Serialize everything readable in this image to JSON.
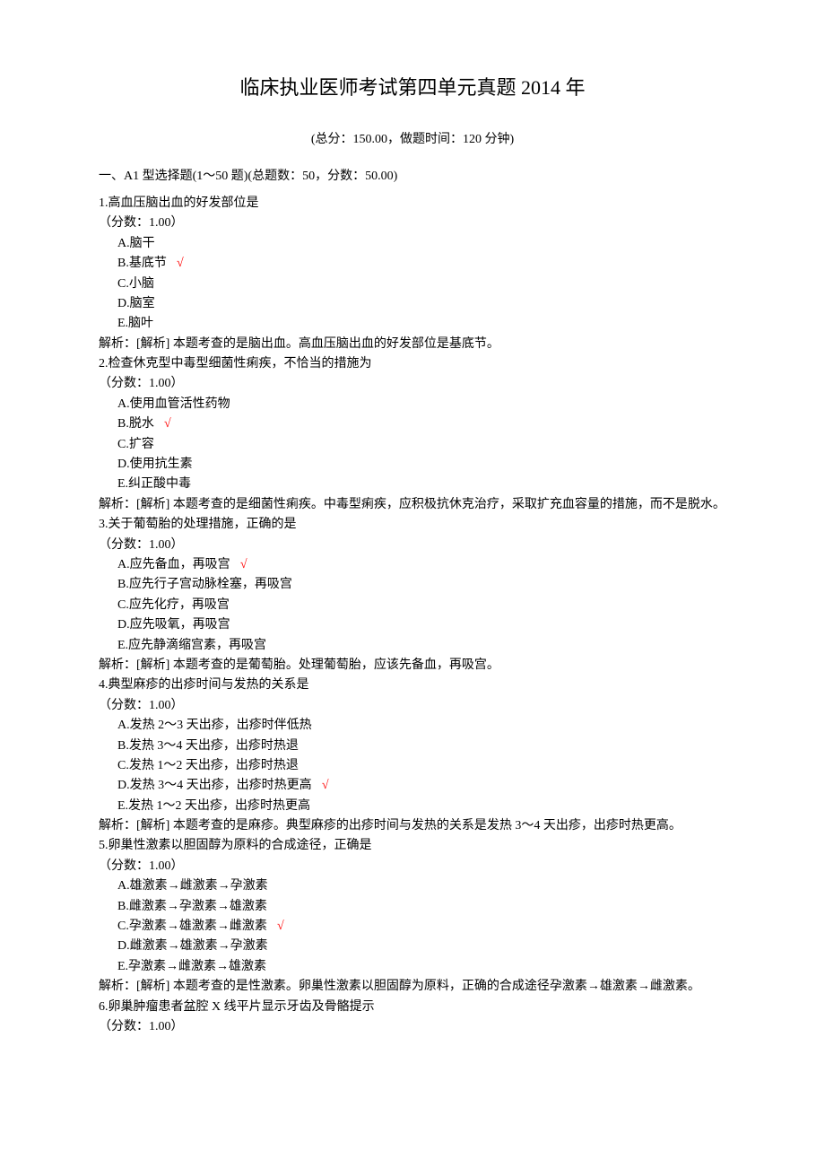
{
  "title": "临床执业医师考试第四单元真题 2014 年",
  "subtitle": "(总分：150.00，做题时间：120 分钟)",
  "section_header": "一、A1 型选择题(1～50 题)(总题数：50，分数：50.00)",
  "check_mark": "√",
  "questions": [
    {
      "num": "1",
      "text": "高血压脑出血的好发部位是",
      "score": "（分数：1.00）",
      "options": [
        {
          "label": "A.脑干",
          "correct": false
        },
        {
          "label": "B.基底节",
          "correct": true
        },
        {
          "label": "C.小脑",
          "correct": false
        },
        {
          "label": "D.脑室",
          "correct": false
        },
        {
          "label": "E.脑叶",
          "correct": false
        }
      ],
      "analysis": "解析：[解析] 本题考查的是脑出血。高血压脑出血的好发部位是基底节。"
    },
    {
      "num": "2",
      "text": "检查休克型中毒型细菌性痢疾，不恰当的措施为",
      "score": "（分数：1.00）",
      "options": [
        {
          "label": "A.使用血管活性药物",
          "correct": false
        },
        {
          "label": "B.脱水",
          "correct": true
        },
        {
          "label": "C.扩容",
          "correct": false
        },
        {
          "label": "D.使用抗生素",
          "correct": false
        },
        {
          "label": "E.纠正酸中毒",
          "correct": false
        }
      ],
      "analysis": "解析：[解析] 本题考查的是细菌性痢疾。中毒型痢疾，应积极抗休克治疗，采取扩充血容量的措施，而不是脱水。"
    },
    {
      "num": "3",
      "text": "关于葡萄胎的处理措施，正确的是",
      "score": "（分数：1.00）",
      "options": [
        {
          "label": "A.应先备血，再吸宫",
          "correct": true
        },
        {
          "label": "B.应先行子宫动脉栓塞，再吸宫",
          "correct": false
        },
        {
          "label": "C.应先化疗，再吸宫",
          "correct": false
        },
        {
          "label": "D.应先吸氧，再吸宫",
          "correct": false
        },
        {
          "label": "E.应先静滴缩宫素，再吸宫",
          "correct": false
        }
      ],
      "analysis": "解析：[解析] 本题考查的是葡萄胎。处理葡萄胎，应该先备血，再吸宫。"
    },
    {
      "num": "4",
      "text": "典型麻疹的出疹时间与发热的关系是",
      "score": "（分数：1.00）",
      "options": [
        {
          "label": "A.发热 2～3 天出疹，出疹时伴低热",
          "correct": false
        },
        {
          "label": "B.发热 3～4 天出疹，出疹时热退",
          "correct": false
        },
        {
          "label": "C.发热 1～2 天出疹，出疹时热退",
          "correct": false
        },
        {
          "label": "D.发热 3～4 天出疹，出疹时热更高",
          "correct": true
        },
        {
          "label": "E.发热 1～2 天出疹，出疹时热更高",
          "correct": false
        }
      ],
      "analysis": "解析：[解析] 本题考查的是麻疹。典型麻疹的出疹时间与发热的关系是发热 3～4 天出疹，出疹时热更高。"
    },
    {
      "num": "5",
      "text": "卵巢性激素以胆固醇为原料的合成途径，正确是",
      "score": "（分数：1.00）",
      "options": [
        {
          "label": "A.雄激素→雌激素→孕激素",
          "correct": false
        },
        {
          "label": "B.雌激素→孕激素→雄激素",
          "correct": false
        },
        {
          "label": "C.孕激素→雄激素→雌激素",
          "correct": true
        },
        {
          "label": "D.雌激素→雄激素→孕激素",
          "correct": false
        },
        {
          "label": "E.孕激素→雌激素→雄激素",
          "correct": false
        }
      ],
      "analysis": "解析：[解析] 本题考查的是性激素。卵巢性激素以胆固醇为原料，正确的合成途径孕激素→雄激素→雌激素。"
    },
    {
      "num": "6",
      "text": "卵巢肿瘤患者盆腔 X 线平片显示牙齿及骨骼提示",
      "score": "（分数：1.00）",
      "options": [],
      "analysis": ""
    }
  ]
}
